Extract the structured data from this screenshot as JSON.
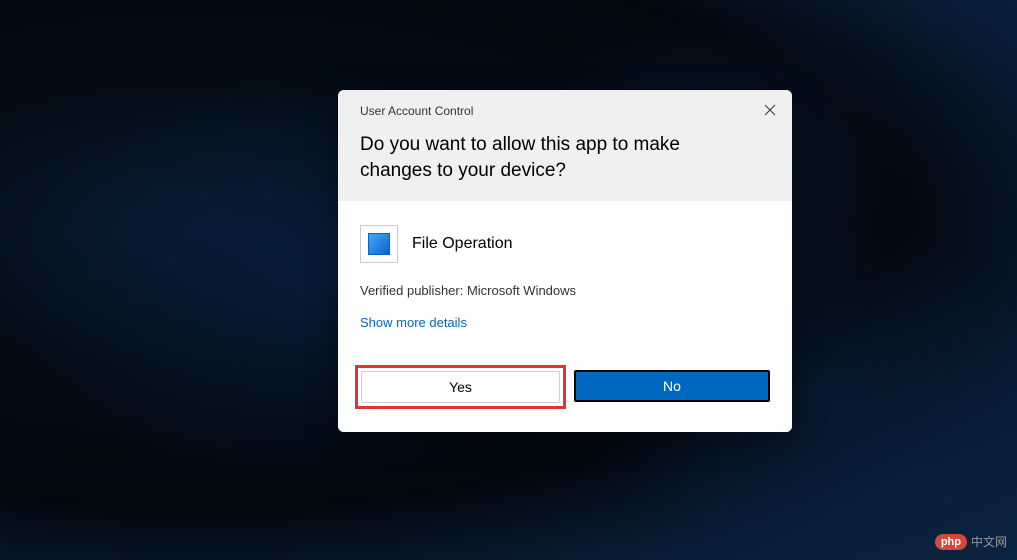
{
  "dialog": {
    "title": "User Account Control",
    "question": "Do you want to allow this app to make changes to your device?",
    "appName": "File Operation",
    "publisherInfo": "Verified publisher: Microsoft Windows",
    "showMoreLabel": "Show more details",
    "yesLabel": "Yes",
    "noLabel": "No"
  },
  "watermark": {
    "badge": "php",
    "text": "中文网"
  }
}
